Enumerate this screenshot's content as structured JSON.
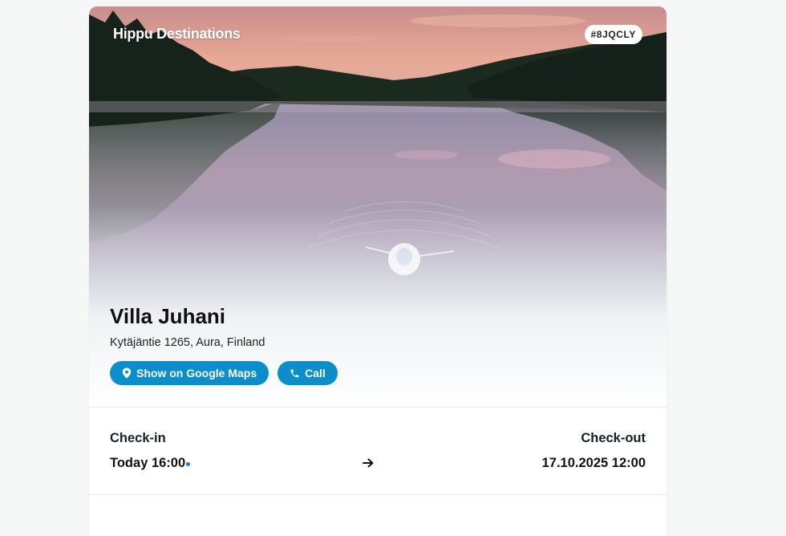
{
  "brand": "Hippu Destinations",
  "booking_code": "#8JQCLY",
  "property": {
    "name": "Villa Juhani",
    "address": "Kytäjäntie 1265, Aura, Finland"
  },
  "actions": {
    "maps_label": "Show on Google Maps",
    "call_label": "Call"
  },
  "stay": {
    "checkin_label": "Check-in",
    "checkin_value": "Today 16:00",
    "checkout_label": "Check-out",
    "checkout_value": "17.10.2025 12:00"
  },
  "icons": {
    "maps": "map-pin-icon",
    "call": "phone-icon",
    "arrow": "arrow-right-icon"
  },
  "colors": {
    "accent": "#0b8ec9",
    "background": "#f6f8f8",
    "card": "#ffffff"
  }
}
